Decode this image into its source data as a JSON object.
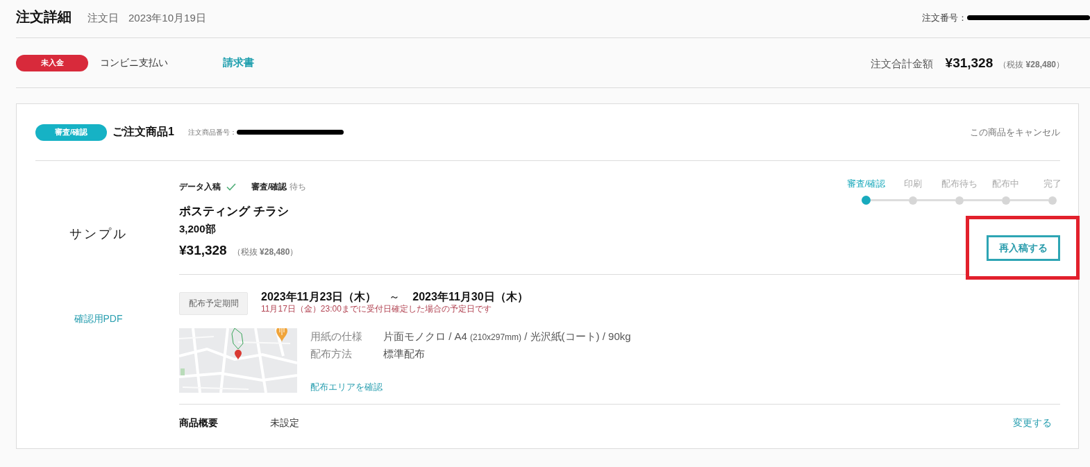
{
  "header": {
    "title": "注文詳細",
    "order_date_label": "注文日",
    "order_date": "2023年10月19日",
    "order_number": {
      "label": "注文番号：",
      "redacted": true
    }
  },
  "payment": {
    "status": "未入金",
    "method": "コンビニ支払い",
    "invoice_link": "請求書",
    "total_label": "注文合計金額",
    "total": "¥31,328",
    "total_tax_excluded": "（税抜 **¥28,480**）"
  },
  "items": [
    {
      "status": "審査/確認",
      "title": "ご注文商品1",
      "item_number": {
        "label": "注文商品番号：",
        "redacted": true
      },
      "cancel_link": "この商品をキャンセル",
      "sample_label": "サンプル",
      "pdf_link": "確認用PDF",
      "progress_checks": [
        {
          "label": "データ入稿",
          "done": true
        },
        {
          "label": "審査/確認",
          "done": false,
          "note": "待ち"
        }
      ],
      "product_name": "ポスティング チラシ",
      "quantity": "3,200部",
      "price": "¥31,328",
      "price_tax_excluded": "（税抜 **¥28,480**）",
      "steps": [
        {
          "label": "審査/確認",
          "selected": true
        },
        {
          "label": "印刷",
          "selected": false
        },
        {
          "label": "配布待ち",
          "selected": false
        },
        {
          "label": "配布中",
          "selected": false
        },
        {
          "label": "完了",
          "selected": false
        }
      ],
      "reupload_button": {
        "label": "再入稿する",
        "highlighted": true
      },
      "distribution_period": {
        "label": "配布予定期間",
        "start": "2023年11月23日（木）",
        "separator": "～",
        "end": "2023年11月30日（木）",
        "note": "11月17日（金）23:00までに受付日確定した場合の予定日です"
      },
      "specs": [
        {
          "label": "用紙の仕様",
          "value": [
            {
              "text": "片面モノクロ / A4 ",
              "small": false
            },
            {
              "text": "(210x297mm)",
              "small": true
            },
            {
              "text": " / 光沢紙(コート) / 90kg",
              "small": false
            }
          ]
        },
        {
          "label": "配布方法",
          "value": [
            {
              "text": "標準配布",
              "small": false
            }
          ]
        }
      ],
      "area_link": "配布エリアを確認",
      "summary": {
        "label": "商品概要",
        "value": "未設定",
        "edit_link": "変更する"
      }
    }
  ]
}
